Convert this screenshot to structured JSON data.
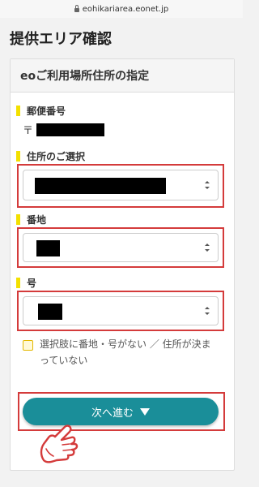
{
  "browser": {
    "url": "eohikariarea.eonet.jp"
  },
  "page": {
    "title": "提供エリア確認"
  },
  "card": {
    "header": "eoご利用場所住所の指定"
  },
  "fields": {
    "postal": {
      "label": "郵便番号",
      "prefix": "〒"
    },
    "address": {
      "label": "住所のご選択"
    },
    "banchi": {
      "label": "番地"
    },
    "go": {
      "label": "号"
    }
  },
  "checkbox": {
    "label": "選択肢に番地・号がない ／ 住所が決まっていない",
    "checked": false
  },
  "next_button": {
    "label": "次へ進む"
  },
  "colors": {
    "accent": "#1a8e99",
    "highlight": "#d43b3b",
    "marker": "#f3e000"
  }
}
